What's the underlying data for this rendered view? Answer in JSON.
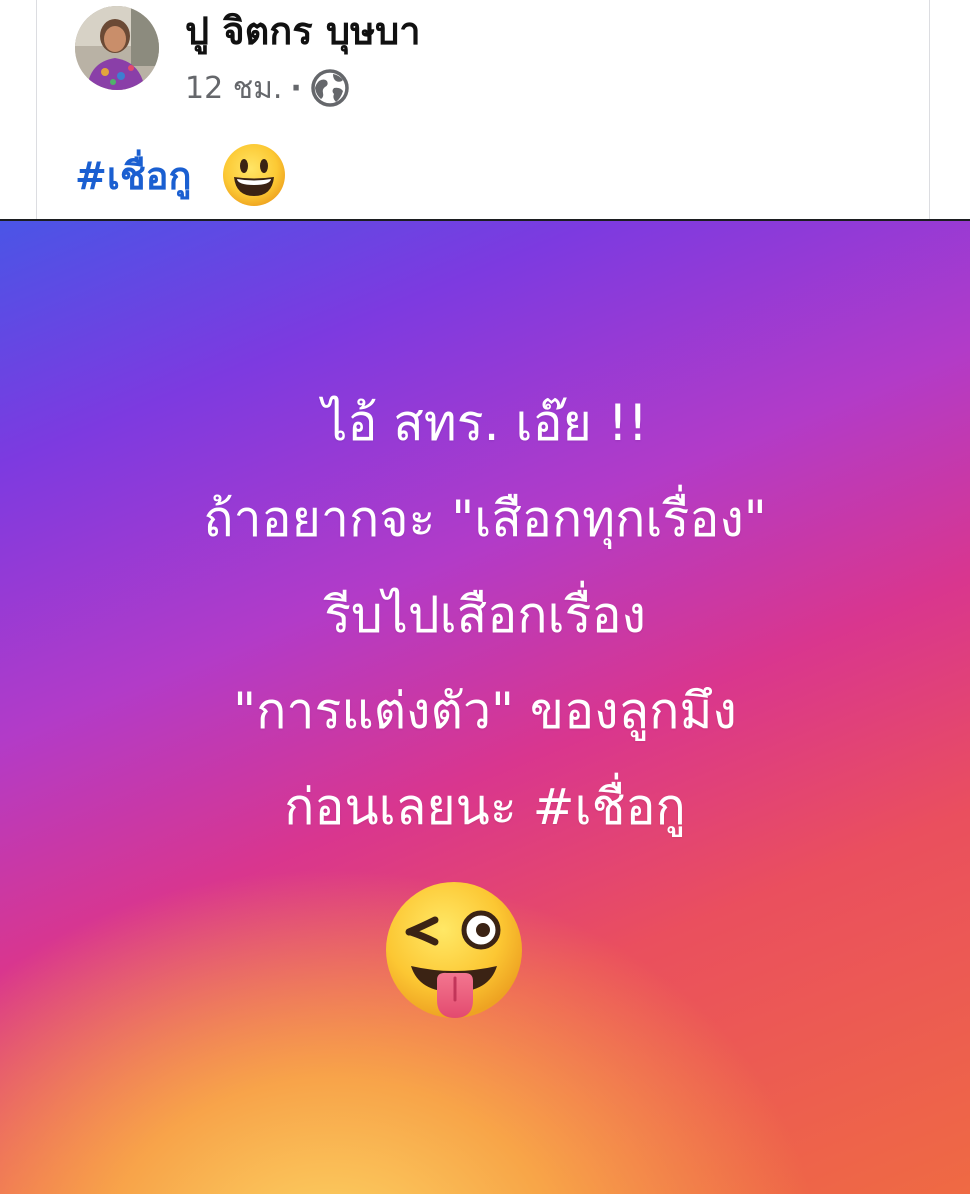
{
  "post": {
    "author_name": "ปู จิตกร บุษบา",
    "timestamp": "12 ชม.",
    "separator": "·",
    "privacy_icon": "globe-icon",
    "caption_hashtag": "#เชื่อกู",
    "caption_emoji": "grinning-face-emoji"
  },
  "background_post": {
    "lines": [
      "ไอ้ สทร. เอ๊ย !!",
      "ถ้าอยากจะ \"เสือกทุกเรื่อง\"",
      "รีบไปเสือกเรื่อง",
      "\"การแต่งตัว\" ของลูกมึง",
      "ก่อนเลยนะ #เชื่อกู"
    ],
    "emoji": "winking-face-with-tongue-emoji",
    "gradient_colors": [
      "#4a55e6",
      "#b23bc8",
      "#d9368e",
      "#ea4f5e",
      "#fcd664"
    ]
  },
  "colors": {
    "hashtag": "#1a5fd1",
    "meta_text": "#65676b",
    "author_text": "#111111",
    "post_text": "#ffffff"
  }
}
